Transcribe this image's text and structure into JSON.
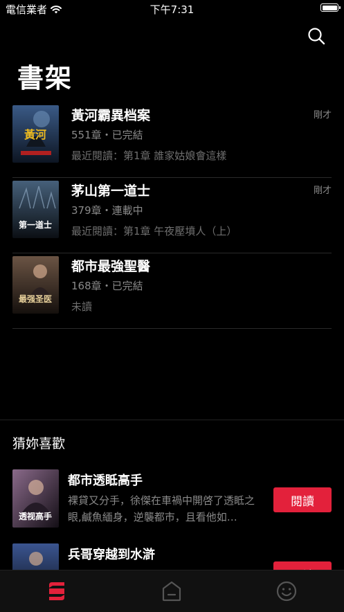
{
  "status_bar": {
    "carrier": "電信業者",
    "time": "下午7:31"
  },
  "header": {
    "title": "書架"
  },
  "shelf": {
    "books": [
      {
        "title": "黃河霸異档案",
        "meta": "551章・已完結",
        "last_read": "最近閱讀：第1章 誰家姑娘會這樣",
        "time": "剛才",
        "cover_colors": [
          "#1d2d44",
          "#3a5a86"
        ],
        "cover_text": "黃河"
      },
      {
        "title": "茅山第一道士",
        "meta": "379章・連載中",
        "last_read": "最近閱讀：第1章 午夜壓墳人（上）",
        "time": "剛才",
        "cover_colors": [
          "#1a2530",
          "#46607a"
        ],
        "cover_text": "第一道士"
      },
      {
        "title": "都市最強聖醫",
        "meta": "168章・已完結",
        "last_read": "未讀",
        "time": "",
        "cover_colors": [
          "#2a1f1a",
          "#6b5444"
        ],
        "cover_text": "最强圣医"
      }
    ]
  },
  "recommendations": {
    "title": "猜妳喜歡",
    "items": [
      {
        "title": "都市透眡高手",
        "desc": "裸貸又分手，徐傑在車禍中開啓了透眡之眼,鹹魚緬身，逆襲都市，且看他如…",
        "button": "閱讀",
        "cover_colors": [
          "#2a2230",
          "#8a6a8a"
        ],
        "cover_text": "透视高手"
      },
      {
        "title": "兵哥穿越到水滸",
        "desc": "",
        "button": "閱讀",
        "cover_colors": [
          "#182238",
          "#3b5590"
        ],
        "cover_text": ""
      }
    ]
  },
  "colors": {
    "accent": "#e3213b",
    "background": "#000000"
  },
  "tab_bar": {
    "tabs": [
      "shelf-tab",
      "home-tab",
      "profile-tab"
    ],
    "active": "shelf-tab"
  }
}
